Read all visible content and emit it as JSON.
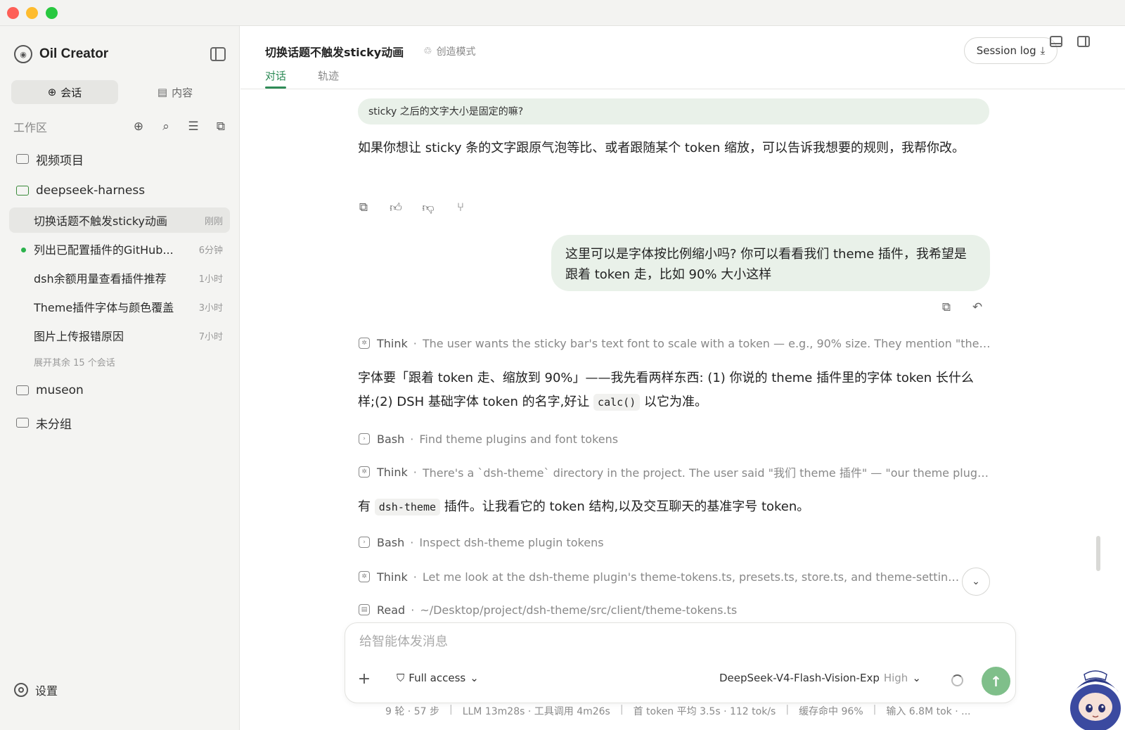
{
  "sidebar": {
    "brand": "Oil Creator",
    "seg_tabs": [
      {
        "icon": "plus-circle-icon",
        "label": "会话"
      },
      {
        "icon": "document-icon",
        "label": "内容"
      }
    ],
    "workspace_label": "工作区",
    "folders_top": [
      {
        "label": "视频项目"
      },
      {
        "label": "deepseek-harness"
      }
    ],
    "sessions": [
      {
        "title": "切换话题不触发sticky动画",
        "time": "刚刚"
      },
      {
        "title": "列出已配置插件的GitHub...",
        "time": "6分钟"
      },
      {
        "title": "dsh余额用量查看插件推荐",
        "time": "1小时"
      },
      {
        "title": "Theme插件字体与颜色覆盖",
        "time": "3小时"
      },
      {
        "title": "图片上传报错原因",
        "time": "7小时"
      }
    ],
    "more": "展开其余 15 个会话",
    "folders_bottom": [
      {
        "label": "museon"
      },
      {
        "label": "未分组"
      }
    ],
    "settings": "设置"
  },
  "header": {
    "title": "切换话题不触发sticky动画",
    "mode": "创造模式",
    "tabs": [
      "对话",
      "轨迹"
    ],
    "session_log": "Session log"
  },
  "chat": {
    "sticky_question": "sticky 之后的文字大小是固定的嘛?",
    "answer1": "如果你想让 sticky 条的文字跟原气泡等比、或者跟随某个 token 缩放，可以告诉我想要的规则，我帮你改。",
    "user_msg": "这里可以是字体按比例缩小吗? 你可以看看我们 theme 插件，我希望是跟着 token 走，比如 90% 大小这样",
    "steps": [
      {
        "kind": "Think",
        "text": "The user wants the sticky bar's text font to scale with a token — e.g., 90% size. They mention \"theme ..."
      },
      {
        "kind": "Bash",
        "text": "Find theme plugins and font tokens"
      },
      {
        "kind": "Think",
        "text": "There's a `dsh-theme` directory in the project. The user said \"我们 theme 插件\" — \"our theme plugin\",..."
      },
      {
        "kind": "Bash",
        "text": "Inspect dsh-theme plugin tokens"
      },
      {
        "kind": "Think",
        "text": "Let me look at the dsh-theme plugin's theme-tokens.ts, presets.ts, store.ts, and theme-settings.ts f..."
      },
      {
        "kind": "Read",
        "text": "~/Desktop/project/dsh-theme/src/client/theme-tokens.ts"
      }
    ],
    "answer2_pre": "字体要「跟着 token 走、缩放到 90%」——我先看两样东西: (1) 你说的 theme 插件里的字体 token 长什么样;(2) DSH 基础字体 token 的名字,好让 ",
    "answer2_code": "calc()",
    "answer2_post": " 以它为准。",
    "answer3_pre": "有 ",
    "answer3_code": "dsh-theme",
    "answer3_post": " 插件。让我看它的 token 结构,以及交互聊天的基准字号 token。"
  },
  "composer": {
    "placeholder": "给智能体发消息",
    "access": "Full access",
    "model": "DeepSeek-V4-Flash-Vision-Exp",
    "level": "High"
  },
  "status": [
    "9 轮 · 57 步",
    "LLM 13m28s · 工具调用 4m26s",
    "首 token 平均 3.5s · 112 tok/s",
    "缓存命中 96%",
    "输入 6.8M tok · ..."
  ],
  "colors": {
    "accent": "#2e8b57",
    "user_bubble": "#e9f1e9",
    "send_button": "#7fbf8a",
    "online_dot": "#2bb24c"
  }
}
